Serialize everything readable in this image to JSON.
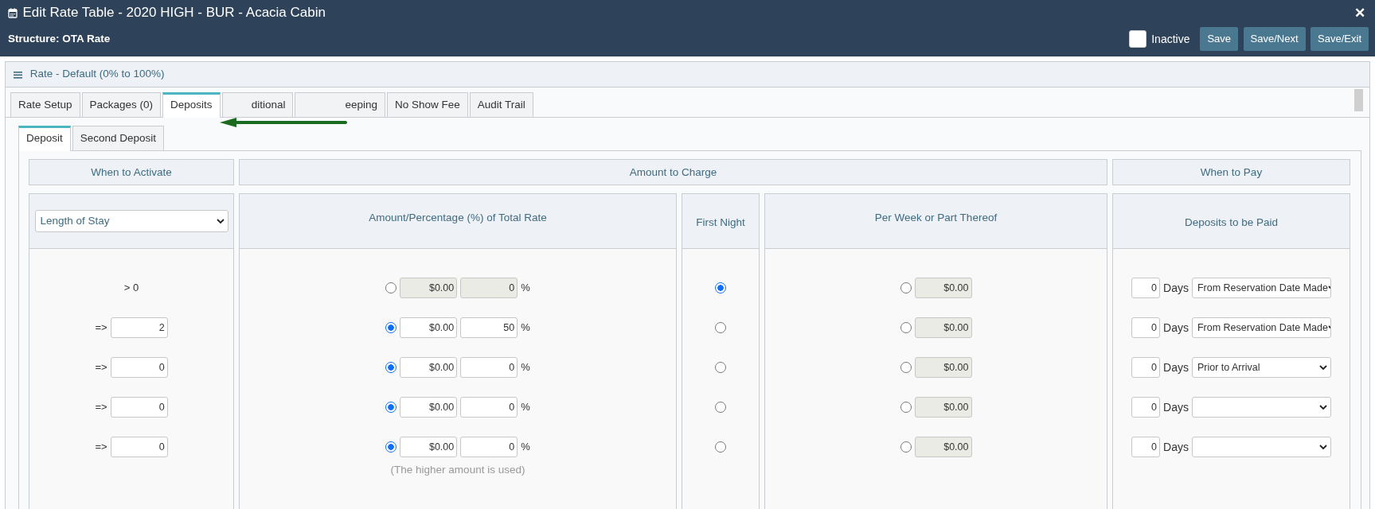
{
  "window": {
    "title": "Edit Rate Table - 2020 HIGH - BUR - Acacia Cabin",
    "close": "✕",
    "structure": "Structure: OTA Rate"
  },
  "inactive": {
    "label": "Inactive",
    "checked": false
  },
  "buttons": [
    "Save",
    "Save/Next",
    "Save/Exit"
  ],
  "panel": {
    "title": "Rate - Default (0% to 100%)"
  },
  "tabs": [
    {
      "label": "Rate Setup",
      "selected": false
    },
    {
      "label": "Packages (0)",
      "selected": false
    },
    {
      "label": "Deposits",
      "selected": true
    },
    {
      "label": "ditional",
      "selected": false
    },
    {
      "label": "eeping",
      "selected": false
    },
    {
      "label": "No Show Fee",
      "selected": false
    },
    {
      "label": "Audit Trail",
      "selected": false
    }
  ],
  "subtabs": [
    {
      "label": "Deposit",
      "selected": true
    },
    {
      "label": "Second Deposit",
      "selected": false
    }
  ],
  "groups": [
    "When to Activate",
    "Amount to Charge",
    "When to Pay"
  ],
  "columns": {
    "activate_select": "Length of Stay",
    "amount": "Amount/Percentage (%) of Total Rate",
    "first_night": "First Night",
    "per_week": "Per Week or Part Thereof",
    "deposits": "Deposits to be Paid"
  },
  "rows": [
    {
      "activate": {
        "kind": "label",
        "text": "> 0"
      },
      "amount": {
        "selected": false,
        "value": "$0.00",
        "percent": "0",
        "unit": "%"
      },
      "first_night": {
        "selected": true
      },
      "per_week": {
        "selected": false,
        "value": "$0.00"
      },
      "pay": {
        "days": "0",
        "unit": "Days",
        "when": "From Reservation Date Made"
      }
    },
    {
      "activate": {
        "kind": "input",
        "prefix": "=>",
        "value": "2"
      },
      "amount": {
        "selected": true,
        "value": "$0.00",
        "percent": "50",
        "unit": "%"
      },
      "first_night": {
        "selected": false
      },
      "per_week": {
        "selected": false,
        "value": "$0.00"
      },
      "pay": {
        "days": "0",
        "unit": "Days",
        "when": "From Reservation Date Made"
      }
    },
    {
      "activate": {
        "kind": "input",
        "prefix": "=>",
        "value": "0"
      },
      "amount": {
        "selected": true,
        "value": "$0.00",
        "percent": "0",
        "unit": "%"
      },
      "first_night": {
        "selected": false
      },
      "per_week": {
        "selected": false,
        "value": "$0.00"
      },
      "pay": {
        "days": "0",
        "unit": "Days",
        "when": "Prior to Arrival"
      }
    },
    {
      "activate": {
        "kind": "input",
        "prefix": "=>",
        "value": "0"
      },
      "amount": {
        "selected": true,
        "value": "$0.00",
        "percent": "0",
        "unit": "%"
      },
      "first_night": {
        "selected": false
      },
      "per_week": {
        "selected": false,
        "value": "$0.00"
      },
      "pay": {
        "days": "0",
        "unit": "Days"
      }
    },
    {
      "activate": {
        "kind": "input",
        "prefix": "=>",
        "value": "0"
      },
      "amount": {
        "selected": true,
        "value": "$0.00",
        "percent": "0",
        "unit": "%"
      },
      "first_night": {
        "selected": false
      },
      "per_week": {
        "selected": false,
        "value": "$0.00"
      },
      "pay": {
        "days": "0",
        "unit": "Days"
      }
    }
  ],
  "amount_note": "(The higher amount is used)"
}
